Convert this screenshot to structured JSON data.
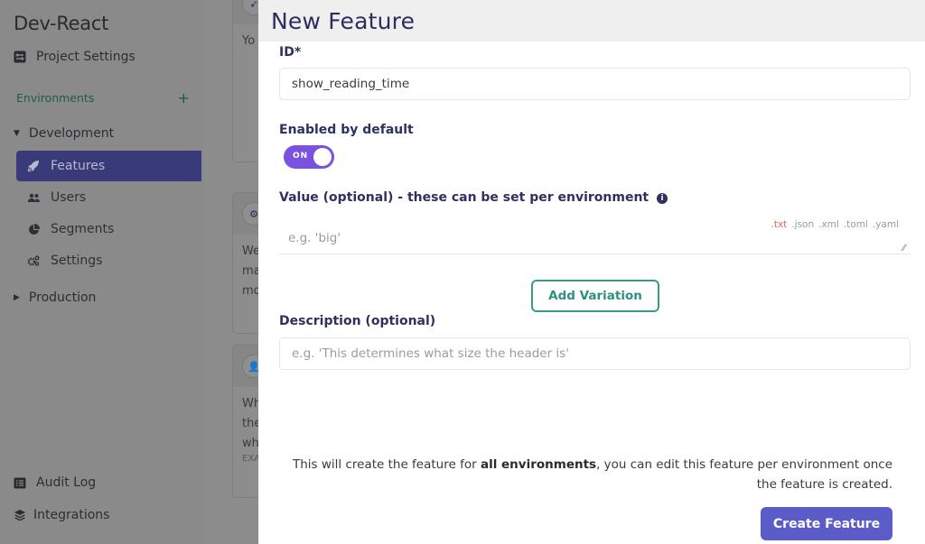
{
  "sidebar": {
    "project_title": "Dev-React",
    "project_settings": "Project Settings",
    "environments_label": "Environments",
    "add_environment": "+",
    "environments": [
      {
        "name": "Development",
        "expanded": true,
        "items": [
          {
            "label": "Features",
            "icon": "rocket-icon",
            "active": true
          },
          {
            "label": "Users",
            "icon": "users-icon",
            "active": false
          },
          {
            "label": "Segments",
            "icon": "pie-chart-icon",
            "active": false
          },
          {
            "label": "Settings",
            "icon": "cogs-icon",
            "active": false
          }
        ]
      },
      {
        "name": "Production",
        "expanded": false
      }
    ],
    "audit_log": "Audit Log",
    "integrations": "Integrations"
  },
  "background_cards": [
    {
      "text": [
        "Yo"
      ]
    },
    {
      "text": [
        "We",
        "ma",
        "mo"
      ]
    },
    {
      "text": [
        "Wh",
        "the",
        "wh"
      ],
      "sub": "EXA"
    }
  ],
  "modal": {
    "title": "New Feature",
    "id_label": "ID*",
    "id_value": "show_reading_time",
    "enabled_label": "Enabled by default",
    "toggle_state": "ON",
    "value_label": "Value (optional) - these can be set per environment",
    "value_info_icon": "i",
    "value_placeholder": "e.g. 'big'",
    "value_formats": [
      ".txt",
      ".json",
      ".xml",
      ".toml",
      ".yaml"
    ],
    "value_format_selected": ".txt",
    "add_variation": "Add Variation",
    "description_label": "Description (optional)",
    "description_placeholder": "e.g. 'This determines what size the header is'",
    "notice_pre": "This will create the feature for ",
    "notice_bold": "all environments",
    "notice_post": ", you can edit this feature per environment once the feature is created.",
    "create_button": "Create Feature"
  },
  "colors": {
    "primary": "#5c5cc9",
    "toggle_on": "#7b51e1",
    "secondary": "#3a9a8a",
    "format_active": "#e6685a",
    "heading": "#2e3160"
  }
}
